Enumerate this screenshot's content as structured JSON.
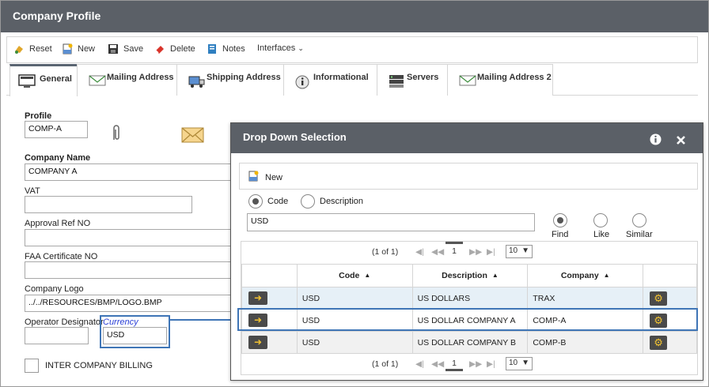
{
  "window": {
    "title": "Company Profile"
  },
  "toolbar": {
    "reset": "Reset",
    "new": "New",
    "save": "Save",
    "delete": "Delete",
    "notes": "Notes",
    "interfaces": "Interfaces"
  },
  "tabs": [
    {
      "label": "General",
      "icon": "monitor-icon",
      "active": true
    },
    {
      "label": "Mailing Address",
      "icon": "envelope-icon"
    },
    {
      "label": "Shipping Address",
      "icon": "truck-icon"
    },
    {
      "label": "Informational",
      "icon": "info-icon"
    },
    {
      "label": "Servers",
      "icon": "server-icon"
    },
    {
      "label": "Mailing Address 2",
      "icon": "envelope-icon"
    }
  ],
  "form": {
    "profile_label": "Profile",
    "profile_value": "COMP-A",
    "company_name_label": "Company Name",
    "company_name_value": "COMPANY A",
    "vat_label": "VAT",
    "vat_value": "",
    "approval_label": "Approval Ref NO",
    "approval_value": "",
    "faa_label": "FAA Certificate NO",
    "faa_value": "",
    "logo_label": "Company Logo",
    "logo_value": "../../RESOURCES/BMP/LOGO.BMP",
    "operator_label": "Operator Designator",
    "operator_value": "",
    "currency_label": "Currency",
    "currency_value": "USD",
    "intercompany_label": "INTER COMPANY BILLING"
  },
  "dialog": {
    "title": "Drop Down Selection",
    "new_label": "New",
    "radio_code": "Code",
    "radio_description": "Description",
    "search_value": "USD",
    "modes": [
      "Find",
      "Like",
      "Similar"
    ],
    "pager": {
      "summary": "(1 of 1)",
      "page": "1",
      "page_size": "10"
    },
    "columns": [
      "Code",
      "Description",
      "Company"
    ],
    "rows": [
      {
        "code": "USD",
        "description": "US DOLLARS",
        "company": "TRAX"
      },
      {
        "code": "USD",
        "description": "US DOLLAR COMPANY A",
        "company": "COMP-A"
      },
      {
        "code": "USD",
        "description": "US DOLLAR COMPANY B",
        "company": "COMP-B"
      }
    ]
  },
  "colors": {
    "titlebar": "#5b6067",
    "highlight": "#3f75b6",
    "currency_label": "#2a3fd6"
  }
}
